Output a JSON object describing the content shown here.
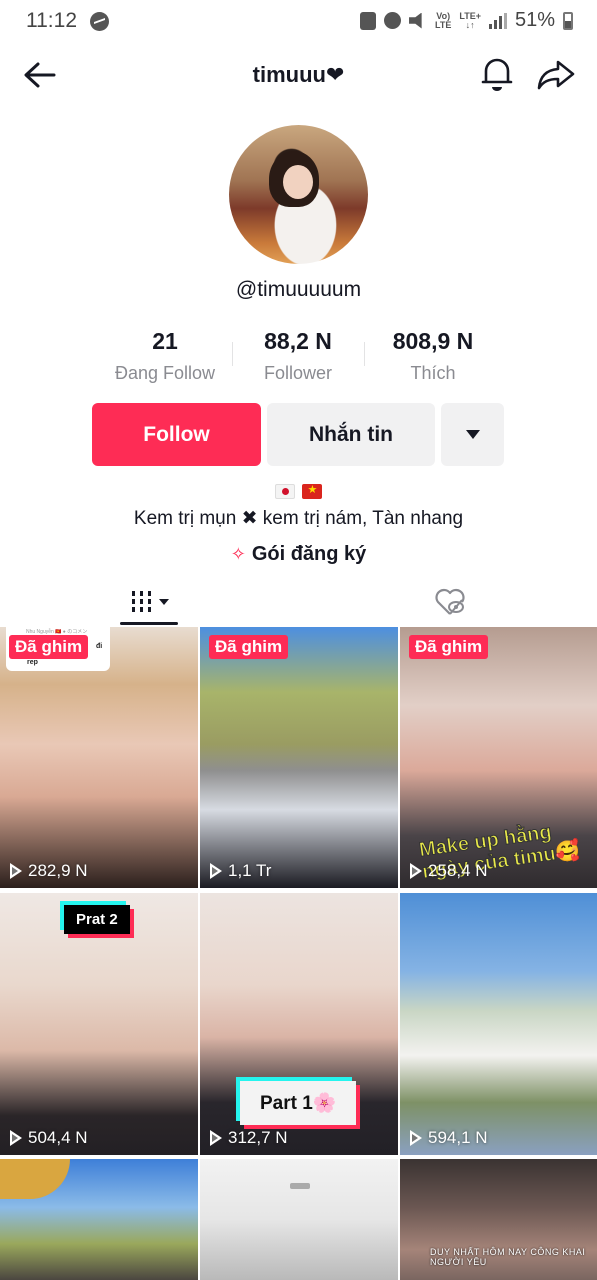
{
  "status_bar": {
    "time": "11:12",
    "network_top": "Vo)",
    "network_bottom": "LTE",
    "lte_top": "LTE+",
    "lte_bottom": "↓↑",
    "battery": "51%"
  },
  "header": {
    "title": "timuuu❤"
  },
  "profile": {
    "username": "@timuuuuum",
    "stats": [
      {
        "value": "21",
        "label": "Đang Follow"
      },
      {
        "value": "88,2 N",
        "label": "Follower"
      },
      {
        "value": "808,9 N",
        "label": "Thích"
      }
    ],
    "follow_label": "Follow",
    "message_label": "Nhắn tin",
    "bio_part1": "Kem trị mụn",
    "bio_sep": "✖",
    "bio_part2": "kem trị nám, Tàn nhang",
    "subscription_icon": "✧",
    "subscription_label": "Gói đăng ký"
  },
  "colors": {
    "accent": "#fe2c55",
    "secondary_button": "#f1f1f2",
    "text": "#161823",
    "muted": "#8a8b91"
  },
  "tabs": [
    {
      "name": "videos",
      "icon": "grid-icon",
      "active": true
    },
    {
      "name": "liked",
      "icon": "liked-hidden-icon",
      "active": false
    }
  ],
  "videos": [
    {
      "pinned": true,
      "pin_label": "Đã ghim",
      "views": "282,9 N",
      "overlay": "",
      "comment_author": "Nhu Nguyễn 🇻🇳 ● のコメントに",
      "comment_line1": "đi",
      "comment_line2": "rep"
    },
    {
      "pinned": true,
      "pin_label": "Đã ghim",
      "views": "1,1 Tr",
      "overlay": ""
    },
    {
      "pinned": true,
      "pin_label": "Đã ghim",
      "views": "258,4 N",
      "overlay": "Make up hằng ngày của timu🥰"
    },
    {
      "pinned": false,
      "views": "504,4 N",
      "overlay": "Prat 2"
    },
    {
      "pinned": false,
      "views": "312,7 N",
      "overlay": "Part 1🌸"
    },
    {
      "pinned": false,
      "views": "594,1 N",
      "overlay": ""
    },
    {
      "pinned": false,
      "views": "",
      "overlay": ""
    },
    {
      "pinned": false,
      "views": "",
      "overlay": ""
    },
    {
      "pinned": false,
      "views": "",
      "overlay": "DUY NHẤT HÔM NAY CÔNG KHAI NGƯỜI YÊU"
    }
  ]
}
